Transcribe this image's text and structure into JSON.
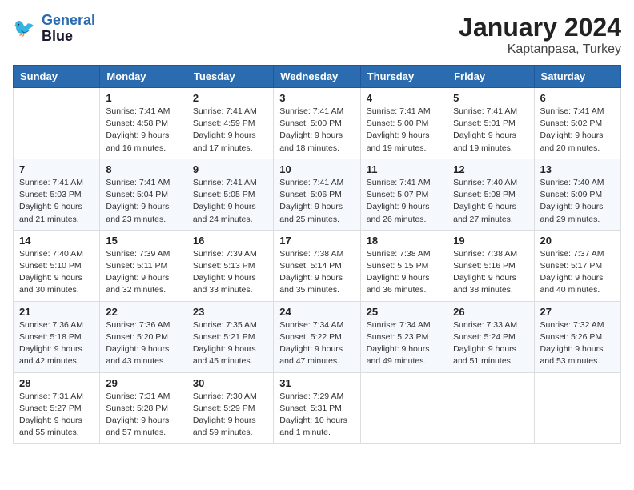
{
  "logo": {
    "line1": "General",
    "line2": "Blue"
  },
  "title": "January 2024",
  "subtitle": "Kaptanpasa, Turkey",
  "days_header": [
    "Sunday",
    "Monday",
    "Tuesday",
    "Wednesday",
    "Thursday",
    "Friday",
    "Saturday"
  ],
  "weeks": [
    [
      {
        "day": "",
        "info": ""
      },
      {
        "day": "1",
        "info": "Sunrise: 7:41 AM\nSunset: 4:58 PM\nDaylight: 9 hours\nand 16 minutes."
      },
      {
        "day": "2",
        "info": "Sunrise: 7:41 AM\nSunset: 4:59 PM\nDaylight: 9 hours\nand 17 minutes."
      },
      {
        "day": "3",
        "info": "Sunrise: 7:41 AM\nSunset: 5:00 PM\nDaylight: 9 hours\nand 18 minutes."
      },
      {
        "day": "4",
        "info": "Sunrise: 7:41 AM\nSunset: 5:00 PM\nDaylight: 9 hours\nand 19 minutes."
      },
      {
        "day": "5",
        "info": "Sunrise: 7:41 AM\nSunset: 5:01 PM\nDaylight: 9 hours\nand 19 minutes."
      },
      {
        "day": "6",
        "info": "Sunrise: 7:41 AM\nSunset: 5:02 PM\nDaylight: 9 hours\nand 20 minutes."
      }
    ],
    [
      {
        "day": "7",
        "info": "Sunrise: 7:41 AM\nSunset: 5:03 PM\nDaylight: 9 hours\nand 21 minutes."
      },
      {
        "day": "8",
        "info": "Sunrise: 7:41 AM\nSunset: 5:04 PM\nDaylight: 9 hours\nand 23 minutes."
      },
      {
        "day": "9",
        "info": "Sunrise: 7:41 AM\nSunset: 5:05 PM\nDaylight: 9 hours\nand 24 minutes."
      },
      {
        "day": "10",
        "info": "Sunrise: 7:41 AM\nSunset: 5:06 PM\nDaylight: 9 hours\nand 25 minutes."
      },
      {
        "day": "11",
        "info": "Sunrise: 7:41 AM\nSunset: 5:07 PM\nDaylight: 9 hours\nand 26 minutes."
      },
      {
        "day": "12",
        "info": "Sunrise: 7:40 AM\nSunset: 5:08 PM\nDaylight: 9 hours\nand 27 minutes."
      },
      {
        "day": "13",
        "info": "Sunrise: 7:40 AM\nSunset: 5:09 PM\nDaylight: 9 hours\nand 29 minutes."
      }
    ],
    [
      {
        "day": "14",
        "info": "Sunrise: 7:40 AM\nSunset: 5:10 PM\nDaylight: 9 hours\nand 30 minutes."
      },
      {
        "day": "15",
        "info": "Sunrise: 7:39 AM\nSunset: 5:11 PM\nDaylight: 9 hours\nand 32 minutes."
      },
      {
        "day": "16",
        "info": "Sunrise: 7:39 AM\nSunset: 5:13 PM\nDaylight: 9 hours\nand 33 minutes."
      },
      {
        "day": "17",
        "info": "Sunrise: 7:38 AM\nSunset: 5:14 PM\nDaylight: 9 hours\nand 35 minutes."
      },
      {
        "day": "18",
        "info": "Sunrise: 7:38 AM\nSunset: 5:15 PM\nDaylight: 9 hours\nand 36 minutes."
      },
      {
        "day": "19",
        "info": "Sunrise: 7:38 AM\nSunset: 5:16 PM\nDaylight: 9 hours\nand 38 minutes."
      },
      {
        "day": "20",
        "info": "Sunrise: 7:37 AM\nSunset: 5:17 PM\nDaylight: 9 hours\nand 40 minutes."
      }
    ],
    [
      {
        "day": "21",
        "info": "Sunrise: 7:36 AM\nSunset: 5:18 PM\nDaylight: 9 hours\nand 42 minutes."
      },
      {
        "day": "22",
        "info": "Sunrise: 7:36 AM\nSunset: 5:20 PM\nDaylight: 9 hours\nand 43 minutes."
      },
      {
        "day": "23",
        "info": "Sunrise: 7:35 AM\nSunset: 5:21 PM\nDaylight: 9 hours\nand 45 minutes."
      },
      {
        "day": "24",
        "info": "Sunrise: 7:34 AM\nSunset: 5:22 PM\nDaylight: 9 hours\nand 47 minutes."
      },
      {
        "day": "25",
        "info": "Sunrise: 7:34 AM\nSunset: 5:23 PM\nDaylight: 9 hours\nand 49 minutes."
      },
      {
        "day": "26",
        "info": "Sunrise: 7:33 AM\nSunset: 5:24 PM\nDaylight: 9 hours\nand 51 minutes."
      },
      {
        "day": "27",
        "info": "Sunrise: 7:32 AM\nSunset: 5:26 PM\nDaylight: 9 hours\nand 53 minutes."
      }
    ],
    [
      {
        "day": "28",
        "info": "Sunrise: 7:31 AM\nSunset: 5:27 PM\nDaylight: 9 hours\nand 55 minutes."
      },
      {
        "day": "29",
        "info": "Sunrise: 7:31 AM\nSunset: 5:28 PM\nDaylight: 9 hours\nand 57 minutes."
      },
      {
        "day": "30",
        "info": "Sunrise: 7:30 AM\nSunset: 5:29 PM\nDaylight: 9 hours\nand 59 minutes."
      },
      {
        "day": "31",
        "info": "Sunrise: 7:29 AM\nSunset: 5:31 PM\nDaylight: 10 hours\nand 1 minute."
      },
      {
        "day": "",
        "info": ""
      },
      {
        "day": "",
        "info": ""
      },
      {
        "day": "",
        "info": ""
      }
    ]
  ]
}
